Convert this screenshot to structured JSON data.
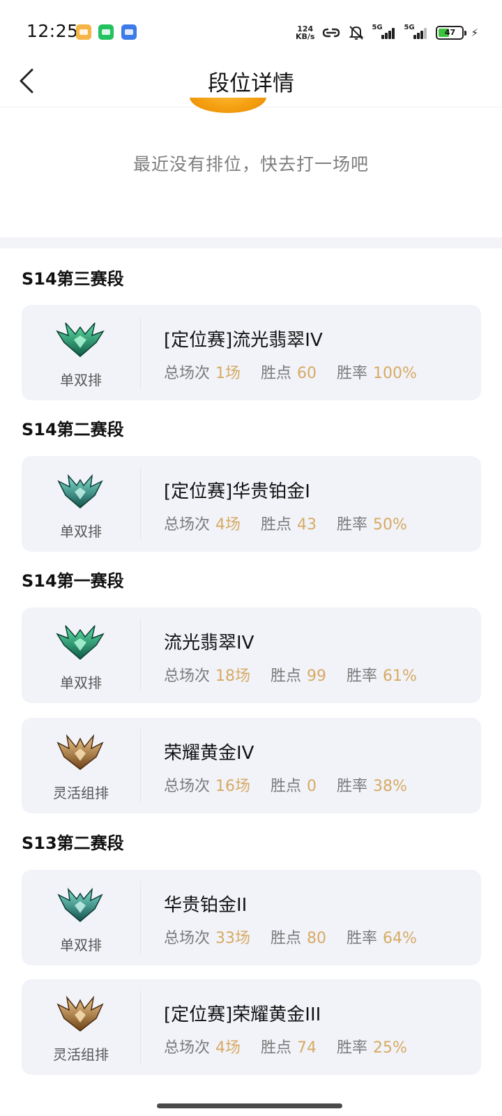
{
  "status_bar": {
    "time": "12:25",
    "speed_value": "124",
    "speed_unit": "KB/s",
    "network_1": "5G",
    "network_2": "5G",
    "battery": "47",
    "battery_level": 0.47,
    "icons": [
      "notification-app-icon",
      "wechat-icon",
      "browser-icon",
      "hotspot-icon",
      "mute-icon",
      "signal-icon",
      "signal-icon",
      "battery-icon",
      "charging-icon"
    ]
  },
  "nav": {
    "back_icon": "chevron-left-icon",
    "title": "段位详情"
  },
  "empty_state": {
    "message": "最近没有排位，快去打一场吧"
  },
  "stat_labels": {
    "games": "总场次",
    "lp": "胜点",
    "winrate": "胜率"
  },
  "colors": {
    "accent": "#d7aa63",
    "card_bg": "#f1f3f9",
    "emerald": "#1f8f72",
    "gold": "#b07a3c"
  },
  "seasons": [
    {
      "title": "S14第三赛段",
      "cards": [
        {
          "queue": "单双排",
          "emblem": "emerald",
          "tier": "[定位赛]流光翡翠IV",
          "games": "1场",
          "lp": "60",
          "winrate": "100%"
        }
      ]
    },
    {
      "title": "S14第二赛段",
      "cards": [
        {
          "queue": "单双排",
          "emblem": "platinum",
          "tier": "[定位赛]华贵铂金I",
          "games": "4场",
          "lp": "43",
          "winrate": "50%"
        }
      ]
    },
    {
      "title": "S14第一赛段",
      "cards": [
        {
          "queue": "单双排",
          "emblem": "emerald",
          "tier": "流光翡翠IV",
          "games": "18场",
          "lp": "99",
          "winrate": "61%"
        },
        {
          "queue": "灵活组排",
          "emblem": "gold",
          "tier": "荣耀黄金IV",
          "games": "16场",
          "lp": "0",
          "winrate": "38%"
        }
      ]
    },
    {
      "title": "S13第二赛段",
      "cards": [
        {
          "queue": "单双排",
          "emblem": "platinum",
          "tier": "华贵铂金II",
          "games": "33场",
          "lp": "80",
          "winrate": "64%"
        },
        {
          "queue": "灵活组排",
          "emblem": "gold",
          "tier": "[定位赛]荣耀黄金III",
          "games": "4场",
          "lp": "74",
          "winrate": "25%"
        }
      ]
    }
  ]
}
